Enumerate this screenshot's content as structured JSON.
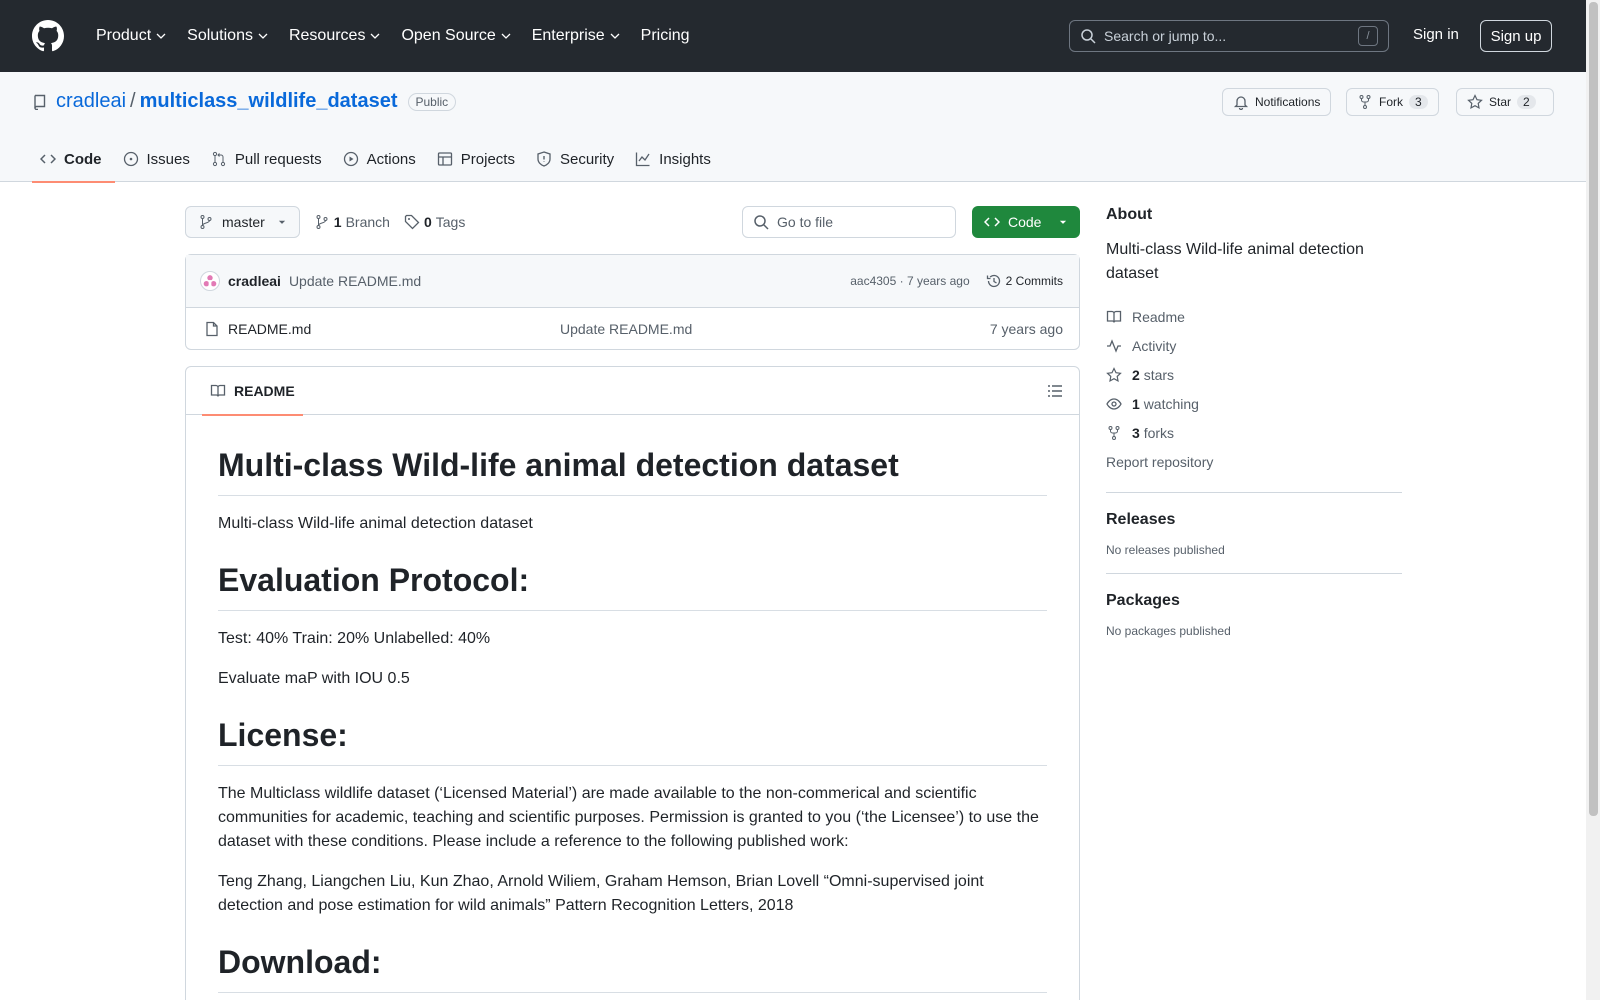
{
  "header": {
    "nav": [
      "Product",
      "Solutions",
      "Resources",
      "Open Source",
      "Enterprise",
      "Pricing"
    ],
    "search_placeholder": "Search or jump to...",
    "search_shortcut": "/",
    "sign_in": "Sign in",
    "sign_up": "Sign up"
  },
  "repo": {
    "owner": "cradleai",
    "separator": "/",
    "name": "multiclass_wildlife_dataset",
    "visibility": "Public",
    "notifications_label": "Notifications",
    "fork_label": "Fork",
    "fork_count": "3",
    "star_label": "Star",
    "star_count": "2"
  },
  "tabs": [
    {
      "label": "Code",
      "icon": "code-icon",
      "active": true
    },
    {
      "label": "Issues",
      "icon": "issue-icon"
    },
    {
      "label": "Pull requests",
      "icon": "pull-request-icon"
    },
    {
      "label": "Actions",
      "icon": "play-icon"
    },
    {
      "label": "Projects",
      "icon": "table-icon"
    },
    {
      "label": "Security",
      "icon": "shield-icon"
    },
    {
      "label": "Insights",
      "icon": "graph-icon"
    }
  ],
  "toolbar": {
    "branch": "master",
    "branch_count": "1",
    "branch_label": "Branch",
    "tag_count": "0",
    "tag_label": "Tags",
    "goto_placeholder": "Go to file",
    "code_button": "Code"
  },
  "latest_commit": {
    "author": "cradleai",
    "message": "Update README.md",
    "meta": "aac4305 · 7 years ago",
    "commits": "2 Commits"
  },
  "files": [
    {
      "name": "README.md",
      "message": "Update README.md",
      "age": "7 years ago"
    }
  ],
  "readme": {
    "tab_label": "README",
    "title": "Multi-class Wild-life animal detection dataset",
    "intro": "Multi-class Wild-life animal detection dataset",
    "h_eval": "Evaluation Protocol:",
    "eval_split": "Test: 40% Train: 20% Unlabelled: 40%",
    "eval_metric": "Evaluate maP with IOU 0.5",
    "h_license": "License:",
    "license_text": "The Multiclass wildlife dataset (‘Licensed Material’) are made available to the non-commerical and scientific communities for academic, teaching and scientific purposes. Permission is granted to you (‘the Licensee’) to use the dataset with these conditions. Please include a reference to the following published work:",
    "citation": "Teng Zhang, Liangchen Liu, Kun Zhao, Arnold Wiliem, Graham Hemson, Brian Lovell “Omni-supervised joint detection and pose estimation for wild animals” Pattern Recognition Letters, 2018",
    "h_download": "Download:"
  },
  "sidebar": {
    "about_title": "About",
    "description": "Multi-class Wild-life animal detection dataset",
    "readme": "Readme",
    "activity": "Activity",
    "stars_count": "2",
    "stars_label": "stars",
    "watching_count": "1",
    "watching_label": "watching",
    "forks_count": "3",
    "forks_label": "forks",
    "report": "Report repository",
    "releases_title": "Releases",
    "releases_text": "No releases published",
    "packages_title": "Packages",
    "packages_text": "No packages published"
  },
  "colors": {
    "header_bg": "#24292f",
    "link": "#0969da",
    "primary_button": "#1f883d",
    "active_tab_underline": "#fd8c73"
  }
}
